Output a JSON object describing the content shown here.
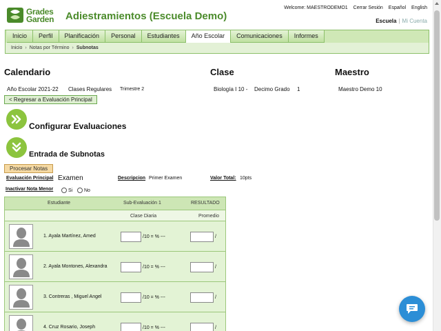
{
  "logo": {
    "line1": "Grades",
    "line2": "Garden"
  },
  "app_title": "Adiestramientos (Escuela Demo)",
  "top_links": {
    "welcome": "Welcome: MAESTRODEMO1",
    "logout": "Cerrar Sesión",
    "lang_es": "Español",
    "lang_en": "English"
  },
  "context": {
    "escuela": "Escuela",
    "mi_cuenta": "Mi Cuenta"
  },
  "nav": {
    "tabs": [
      "Inicio",
      "Perfil",
      "Planificación",
      "Personal",
      "Estudiantes",
      "Año Escolar",
      "Comunicaciones",
      "Informes"
    ],
    "active_tab": "Año Escolar",
    "breadcrumb": [
      "Inicio",
      "Notas por Término",
      "Subnotas"
    ]
  },
  "headers": {
    "calendario": "Calendario",
    "clase": "Clase",
    "maestro": "Maestro"
  },
  "info": {
    "ano_escolar": "Año Escolar 2021-22",
    "clases": "Clases Regulares",
    "trimestre": "Trimestre 2",
    "clase": "Biología I 10 -",
    "grado": "Decimo Grado",
    "grupo": "1",
    "maestro": "Maestro Demo 10"
  },
  "back_button": "< Regresar a Evaluación Principal",
  "sections": {
    "configurar": "Configurar Evaluaciones",
    "entrada": "Entrada de Subnotas"
  },
  "process_button": "Procesar Notas",
  "evaluation": {
    "principal_label": "Evaluación Principal",
    "principal_value": "Examen",
    "descripcion_label": "Descripcion",
    "descripcion_value": "Primer Examen",
    "valor_label": "Valor Total:",
    "valor_value": "10pts",
    "inactivar_label": "Inactivar Nota Menor",
    "si": "Si",
    "no": "No"
  },
  "grid": {
    "col_estudiante": "Estudiante",
    "col_sub": "Sub-Evaluación 1",
    "col_resultado": "RESULTADO",
    "sub_name": "Clase Diaria",
    "promedio": "Promedio",
    "calc_text": "/10 = % ---",
    "slash": "/",
    "students": [
      {
        "name": "1. Ayala Martínez, Amed"
      },
      {
        "name": "2. Ayala Montones, Alexandra"
      },
      {
        "name": "3. Contreras , Miguel Angel"
      },
      {
        "name": "4. Cruz Rosario, Joseph"
      }
    ]
  },
  "icons": {
    "chat": "chat-bubble-icon",
    "expand": "double-chevron-right-icon",
    "collapse": "double-chevron-down-icon"
  }
}
